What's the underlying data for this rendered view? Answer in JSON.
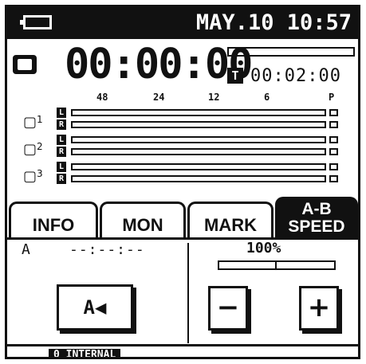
{
  "status_bar": {
    "datetime": "MAY.10 10:57",
    "battery_icon": "battery-icon"
  },
  "recorder": {
    "elapsed_time": "00:00:00",
    "t_badge": "T",
    "remaining_time": "00:02:00"
  },
  "meters": {
    "scale_labels": [
      "48",
      "24",
      "12",
      "6",
      "P"
    ],
    "channels": [
      {
        "label": "1",
        "rows": [
          "L",
          "R"
        ]
      },
      {
        "label": "2",
        "rows": [
          "L",
          "R"
        ]
      },
      {
        "label": "3",
        "rows": [
          "L",
          "R"
        ]
      }
    ]
  },
  "tabs": [
    {
      "label": "INFO"
    },
    {
      "label": "MON"
    },
    {
      "label": "MARK"
    },
    {
      "label": "A-B",
      "sub": "SPEED",
      "active": true
    }
  ],
  "ab_panel": {
    "a_label": "A",
    "a_time": "--:--:--",
    "button_label": "A◀"
  },
  "speed_panel": {
    "speed_value": "100%",
    "minus_label": "−",
    "plus_label": "+"
  },
  "bottom_bar": {
    "index": "0",
    "storage": "INTERNAL"
  }
}
